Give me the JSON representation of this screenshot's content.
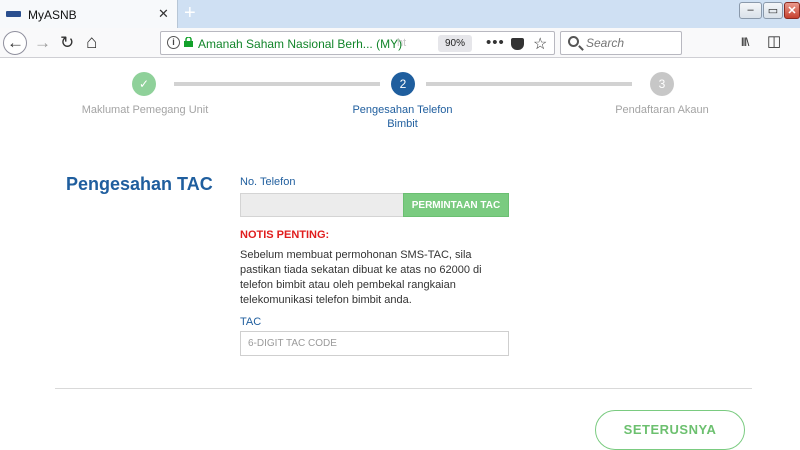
{
  "browser": {
    "tab_title": "MyASNB",
    "tab_close": "✕",
    "new_tab": "+",
    "url_site": "Amanah Saham Nasional Berh... (MY)",
    "url_hint": "ht",
    "zoom": "90%",
    "menu_dots": "•••",
    "search_placeholder": "Search",
    "window_minimize": "–",
    "window_restore": "▭",
    "window_close": "✕",
    "icons": {
      "back": "←",
      "forward": "→",
      "reload": "↻",
      "home": "⌂",
      "star": "☆",
      "library": "lll\\",
      "sidebar": "◫"
    }
  },
  "steps": [
    {
      "number": "✓",
      "label": "Maklumat Pemegang Unit",
      "state": "done",
      "color": "#8fd19a"
    },
    {
      "number": "2",
      "label": "Pengesahan Telefon Bimbit",
      "state": "active",
      "color": "#1f5e9e"
    },
    {
      "number": "3",
      "label": "Pendaftaran Akaun",
      "state": "pending",
      "color": "#c7c7c7"
    }
  ],
  "form": {
    "title": "Pengesahan TAC",
    "phone_label": "No. Telefon",
    "phone_value": "",
    "request_tac_button": "PERMINTAAN TAC",
    "notice_title": "NOTIS PENTING:",
    "notice_text": "Sebelum membuat permohonan SMS-TAC, sila pastikan tiada sekatan dibuat ke atas no 62000 di telefon bimbit atau oleh pembekal rangkaian telekomunikasi telefon bimbit anda.",
    "tac_label": "TAC",
    "tac_placeholder": "6-DIGIT TAC CODE",
    "next_button": "SETERUSNYA"
  },
  "colors": {
    "primary_blue": "#1f5e9e",
    "green": "#7acb80",
    "notice_red": "#e01d1d"
  }
}
